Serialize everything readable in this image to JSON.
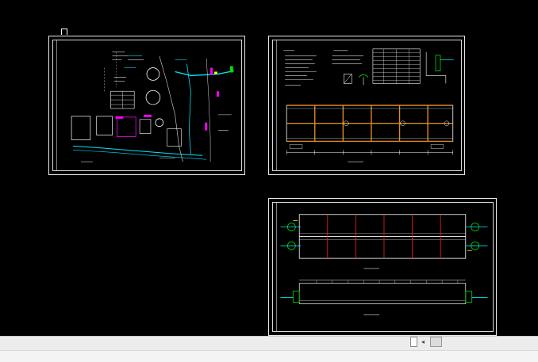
{
  "viewport": {
    "name": "cad-model-space",
    "background": "#000000",
    "sheets": [
      {
        "id": "site-plan",
        "kind": "drawing-sheet"
      },
      {
        "id": "notes-and-plan",
        "kind": "drawing-sheet"
      },
      {
        "id": "plan-and-section",
        "kind": "drawing-sheet"
      }
    ]
  },
  "colors": {
    "frame": "#e8e8e8",
    "cyan": "#00e5ff",
    "magenta": "#ff00ff",
    "orange": "#e08a1e",
    "red": "#ff2020",
    "green": "#00e000",
    "yellow": "#ffff00",
    "white": "#ffffff"
  },
  "scrollbar": {
    "left_arrow_icon": "◂"
  },
  "icons": {
    "ucs": "ucs-icon",
    "scroll_left": "left-arrow-icon"
  }
}
